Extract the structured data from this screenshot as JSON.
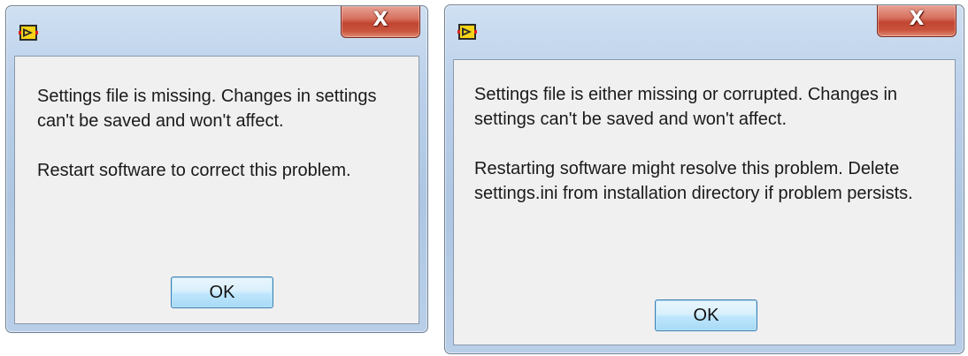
{
  "colors": {
    "frame": "#b9cfe8",
    "close_button": "#c9533d",
    "content_bg": "#f0f0f0",
    "ok_button": "#bee6fd"
  },
  "dialogs": [
    {
      "close_glyph": "X",
      "app_icon": "labview-vi-icon",
      "paragraphs": [
        "Settings file is missing. Changes in settings can't be saved and won't affect.",
        "Restart software to correct this problem."
      ],
      "ok_label": "OK"
    },
    {
      "close_glyph": "X",
      "app_icon": "labview-vi-icon",
      "paragraphs": [
        "Settings file is either missing or corrupted. Changes in settings can't be saved and won't affect.",
        "Restarting software might resolve this problem. Delete settings.ini from installation directory if problem persists."
      ],
      "ok_label": "OK"
    }
  ]
}
